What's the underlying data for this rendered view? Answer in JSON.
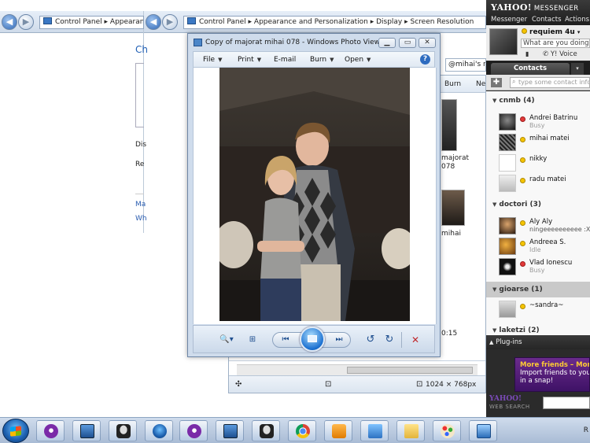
{
  "cp_left": {
    "address": "Control Panel ▸ Appearance",
    "heading": "Ch",
    "labels": [
      "Dis",
      "Re"
    ],
    "links": [
      "Ma",
      "Wh"
    ]
  },
  "cp_right": {
    "address": "Control Panel  ▸  Appearance and Personalization  ▸  Display  ▸  Screen Resolution"
  },
  "explorer": {
    "search": "@mihai's r",
    "toolbar": [
      "Burn",
      "Ne"
    ],
    "items": [
      {
        "label_line1": "majorat",
        "label_line2": "078"
      },
      {
        "label_line1": "mihai",
        "label_line2": ""
      }
    ],
    "time_fragment": "0:15",
    "dimensions": "1024 × 768px"
  },
  "photo_viewer": {
    "title": "Copy of majorat mihai 078 - Windows Photo Viewer",
    "menu": [
      "File",
      "Print",
      "E-mail",
      "Burn",
      "Open"
    ],
    "help": "?",
    "window_controls": {
      "minimize": "▁",
      "maximize": "▭",
      "close": "✕"
    },
    "controls": {
      "zoom": "🔍▾",
      "fit": "⊞",
      "prev": "⏮",
      "next": "⏭",
      "rotate_ccw": "↺",
      "rotate_cw": "↻",
      "delete": "✕"
    },
    "colors": {
      "delete": "#c0282b"
    }
  },
  "messenger": {
    "logo": "YAHOO!",
    "logo_sub": "MESSENGER",
    "menu": [
      "Messenger",
      "Contacts",
      "Actions"
    ],
    "user": "requiem 4u",
    "status_placeholder": "What are you doing?",
    "voice": "Y! Voice",
    "tab": "Contacts",
    "search_placeholder": "type some contact infor",
    "groups": [
      {
        "name": "cnmb (4)",
        "contacts": [
          {
            "name": "Andrei Batrinu",
            "status": "busy",
            "sub": "Busy"
          },
          {
            "name": "mihai matei",
            "status": "online",
            "sub": ""
          },
          {
            "name": "nikky",
            "status": "online",
            "sub": ""
          },
          {
            "name": "radu matei",
            "status": "online",
            "sub": ""
          }
        ]
      },
      {
        "name": "doctori (3)",
        "contacts": [
          {
            "name": "Aly Aly",
            "status": "online",
            "sub": "ningeeeeeeeeee :X"
          },
          {
            "name": "Andreea S.",
            "status": "online",
            "sub": "Idle"
          },
          {
            "name": "Vlad Ionescu",
            "status": "busy",
            "sub": "Busy"
          }
        ]
      },
      {
        "name": "gioarse (1)",
        "contacts": [
          {
            "name": "~sandra~",
            "status": "online",
            "sub": ""
          }
        ]
      },
      {
        "name": "laketzi (2)",
        "contacts": []
      }
    ],
    "plugins": "Plug-ins",
    "ad_headline": "More friends – More f",
    "ad_line1": "Import friends to your li",
    "ad_line2": "in a snap!",
    "websearch_logo": "YAHOO!",
    "websearch_sub": "WEB SEARCH"
  },
  "taskbar": {
    "icons": [
      "yahoo-messenger",
      "monitor",
      "alien",
      "start-orb",
      "yahoo-messenger",
      "monitor",
      "alien",
      "chrome",
      "media-player",
      "network",
      "folder",
      "paint",
      "photo-viewer"
    ],
    "clock": "R"
  }
}
